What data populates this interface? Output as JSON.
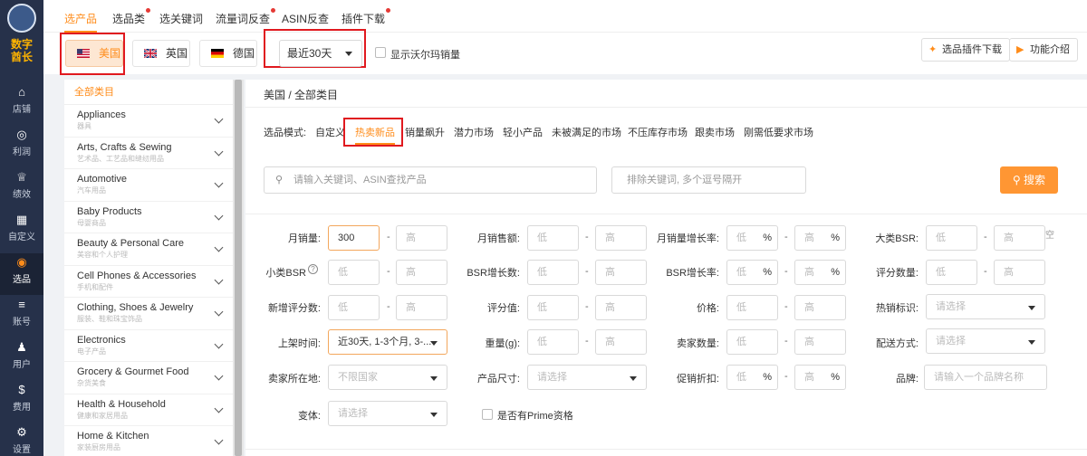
{
  "nav": {
    "brand_line1": "数字",
    "brand_line2": "酋长",
    "items": [
      {
        "icon": "⌂",
        "label": "店铺"
      },
      {
        "icon": "◎",
        "label": "利润"
      },
      {
        "icon": "♕",
        "label": "绩效"
      },
      {
        "icon": "▦",
        "label": "自定义"
      },
      {
        "icon": "◉",
        "label": "选品"
      },
      {
        "icon": "≡",
        "label": "账号"
      },
      {
        "icon": "♟",
        "label": "用户"
      },
      {
        "icon": "$",
        "label": "费用"
      },
      {
        "icon": "⚙",
        "label": "设置"
      }
    ]
  },
  "topbar": {
    "tabs": [
      {
        "label": "选产品"
      },
      {
        "label": "选品类"
      },
      {
        "label": "选关键词"
      },
      {
        "label": "流量词反查"
      },
      {
        "label": "ASIN反查"
      },
      {
        "label": "插件下载"
      }
    ]
  },
  "countries": [
    {
      "label": "美国"
    },
    {
      "label": "英国"
    },
    {
      "label": "德国"
    }
  ],
  "period": {
    "value": "最近30天"
  },
  "walmart": {
    "label": "显示沃尔玛销量"
  },
  "right_buttons": {
    "plugin": "选品插件下载",
    "intro": "功能介绍"
  },
  "categories": {
    "all": "全部类目",
    "items": [
      {
        "en": "Appliances",
        "zh": "器具"
      },
      {
        "en": "Arts, Crafts & Sewing",
        "zh": "艺术品、工艺品和缝纫用品"
      },
      {
        "en": "Automotive",
        "zh": "汽车用品"
      },
      {
        "en": "Baby Products",
        "zh": "母婴商品"
      },
      {
        "en": "Beauty & Personal Care",
        "zh": "美容和个人护理"
      },
      {
        "en": "Cell Phones & Accessories",
        "zh": "手机和配件"
      },
      {
        "en": "Clothing, Shoes & Jewelry",
        "zh": "服装、鞋和珠宝饰品"
      },
      {
        "en": "Electronics",
        "zh": "电子产品"
      },
      {
        "en": "Grocery & Gourmet Food",
        "zh": "杂货美食"
      },
      {
        "en": "Health & Household",
        "zh": "健康和家居用品"
      },
      {
        "en": "Home & Kitchen",
        "zh": "家装厨房用品"
      }
    ]
  },
  "main": {
    "breadcrumb": "美国 / 全部类目",
    "mode_label": "选品模式:",
    "modes": [
      "自定义",
      "热卖新品",
      "销量飙升",
      "潜力市场",
      "轻小产品",
      "未被满足的市场",
      "不压库存市场",
      "跟卖市场",
      "刚需低要求市场"
    ],
    "search_placeholder": "请输入关键词、ASIN查找产品",
    "exclude_placeholder": "排除关键词, 多个逗号隔开",
    "search_button": "搜索",
    "low": "低",
    "high": "高",
    "pct": "%",
    "dash": "-",
    "select": "请选择",
    "trail": "空",
    "fields": {
      "monthly_sales": "月销量:",
      "monthly_sales_value": "300",
      "monthly_revenue": "月销售额:",
      "sales_growth": "月销量增长率:",
      "big_bsr": "大类BSR:",
      "small_bsr": "小类BSR",
      "bsr_growth_count": "BSR增长数:",
      "bsr_growth_rate": "BSR增长率:",
      "rating_count": "评分数量:",
      "new_ratings": "新增评分数:",
      "rating": "评分值:",
      "price": "价格:",
      "hot_tag": "热销标识:",
      "launch_time": "上架时间:",
      "launch_value": "近30天, 1-3个月, 3-...",
      "weight": "重量(g):",
      "seller_count": "卖家数量:",
      "fulfillment": "配送方式:",
      "seller_country": "卖家所在地:",
      "seller_country_value": "不限国家",
      "size": "产品尺寸:",
      "discount": "促销折扣:",
      "brand": "品牌:",
      "brand_placeholder": "请输入一个品牌名称",
      "variants": "变体:",
      "prime": "是否有Prime资格"
    }
  }
}
